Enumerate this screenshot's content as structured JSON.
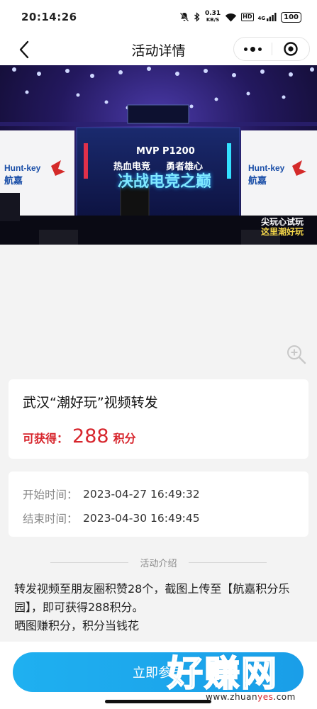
{
  "status_bar": {
    "time": "20:14:26",
    "net_speed_value": "0.31",
    "net_speed_unit": "KB/S",
    "hd_badge": "HD",
    "signal_label": "4G",
    "battery": "100"
  },
  "navbar": {
    "title": "活动详情"
  },
  "hero": {
    "brand_left": "Hunt-key",
    "brand_left_cn": "航嘉",
    "brand_right": "Hunt-key",
    "brand_right_cn": "航嘉",
    "screen_model": "MVP P1200",
    "screen_slogan_1": "热血电竞",
    "screen_slogan_2": "勇者雄心",
    "screen_headline": "决战电竞之巅",
    "corner_text_1": "尖玩心试玩",
    "corner_text_2": "这里潮好玩"
  },
  "activity": {
    "name": "武汉“潮好玩”视频转发",
    "reward_label": "可获得：",
    "reward_points": "288",
    "reward_unit": "积分"
  },
  "time_info": {
    "start_label": "开始时间：",
    "start_value": "2023-04-27 16:49:32",
    "end_label": "结束时间：",
    "end_value": "2023-04-30 16:49:45"
  },
  "intro": {
    "section_title": "活动介绍",
    "line1": "转发视频至朋友圈积赞28个，截图上传至【航嘉积分乐园】，即可获得288积分。",
    "line2": "晒图赚积分，积分当钱花"
  },
  "bottom": {
    "join_label": "立即参与"
  },
  "watermark": {
    "big": "好赚网",
    "small_prefix": "www.zhuan",
    "small_mid": "yes",
    "small_suffix": ".com"
  },
  "colors": {
    "accent_blue": "#1fb0f0",
    "reward_red": "#d7262d"
  }
}
